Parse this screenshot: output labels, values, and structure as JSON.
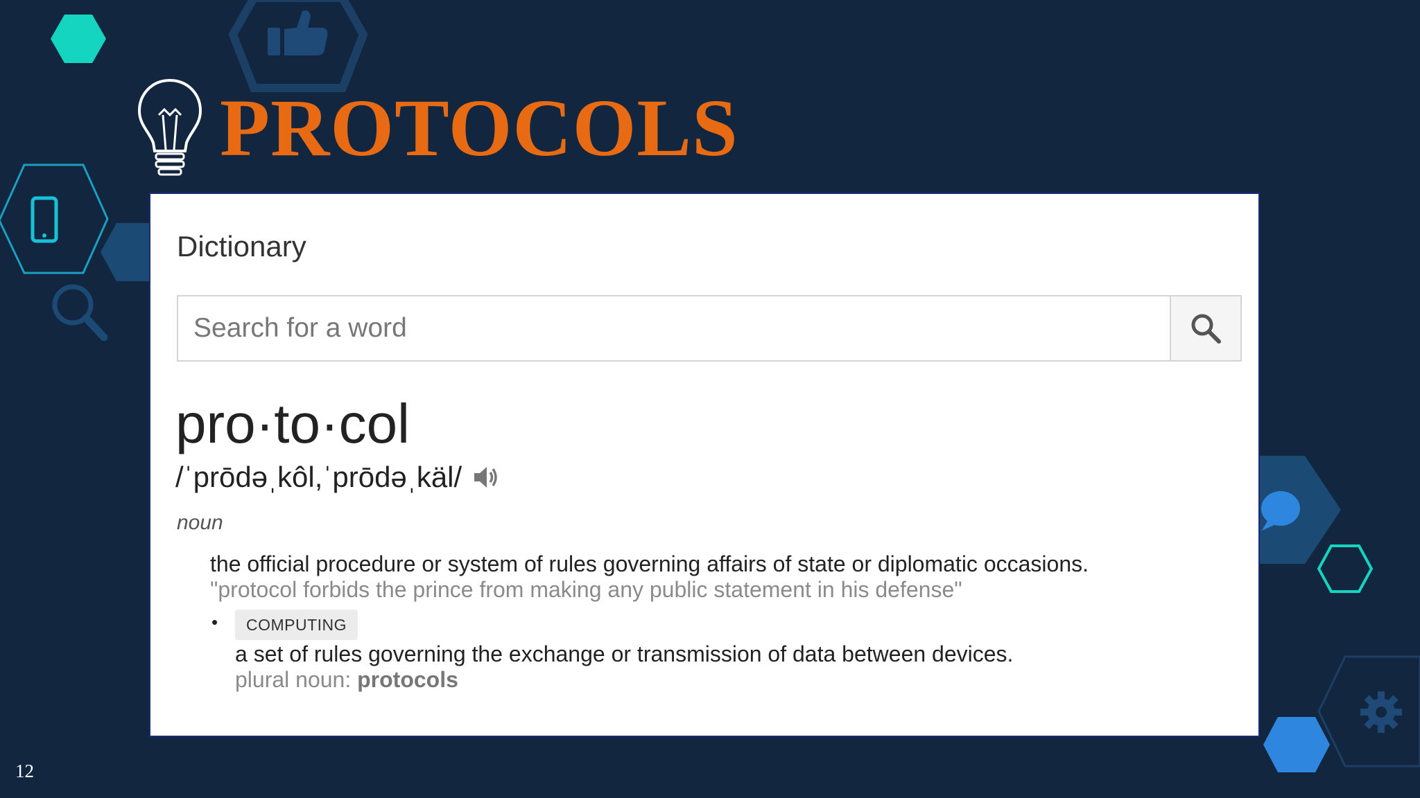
{
  "slide": {
    "title": "PROTOCOLS",
    "page_number": "12",
    "colors": {
      "background": "#12263f",
      "title": "#e86a12",
      "accent_teal": "#14d6c0",
      "accent_blue": "#2e86de",
      "deco_dark": "#1b4a75"
    }
  },
  "dictionary": {
    "label": "Dictionary",
    "search_placeholder": "Search for a word",
    "headword": "pro·to·col",
    "pronunciation": "/ˈprōdəˌkôl,ˈprōdəˌkäl/",
    "part_of_speech": "noun",
    "definitions": [
      {
        "text": "the official procedure or system of rules governing affairs of state or diplomatic occasions.",
        "example": "\"protocol forbids the prince from making any public statement in his defense\""
      },
      {
        "bullet": "•",
        "tag": "COMPUTING",
        "text": "a set of rules governing the exchange or transmission of data between devices.",
        "plural_label": "plural noun:",
        "plural_value": "protocols"
      }
    ]
  },
  "icons": [
    "lightbulb-icon",
    "thumbs-up-icon",
    "phone-icon",
    "magnifier-icon",
    "chat-bubble-icon",
    "gear-icon",
    "search-icon",
    "speaker-icon"
  ]
}
